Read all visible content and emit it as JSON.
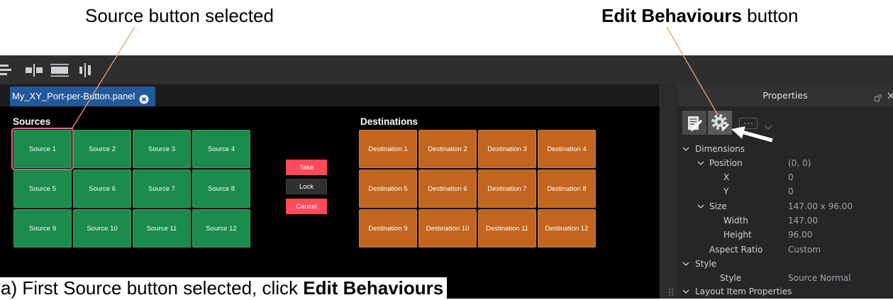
{
  "annotations": {
    "source_callout": "Source button selected",
    "edit_callout_bold": "Edit Behaviours",
    "edit_callout_rest": "button",
    "caption_text": "a) First Source button selected, click",
    "caption_bold": "Edit Behaviours",
    "line_color": "#f2a068"
  },
  "toolbar": {
    "icons": [
      "align-left-icon",
      "align-horizontal-centers-icon",
      "distribute-vertical-icon",
      "align-vertical-centers-icon"
    ]
  },
  "tab": {
    "label": "My_XY_Port-per-Button.panel",
    "close_icon": "close-circle-icon"
  },
  "panel": {
    "sources_title": "Sources",
    "destinations_title": "Destinations",
    "sources": [
      "Source 1",
      "Source 2",
      "Source 3",
      "Source 4",
      "Source 5",
      "Source 6",
      "Source 7",
      "Source 8",
      "Source 9",
      "Source 10",
      "Source 11",
      "Source 12"
    ],
    "selected_source_index": 0,
    "destinations": [
      "Destination 1",
      "Destination 2",
      "Destination 3",
      "Destination 4",
      "Destination 5",
      "Destination 6",
      "Destination 7",
      "Destination 8",
      "Destination 9",
      "Destination 10",
      "Destination 11",
      "Destination 12"
    ],
    "take_label": "Take",
    "lock_label": "Lock",
    "cancel_label": "Cancel",
    "colors": {
      "source": "#1b8c4c",
      "destination": "#c2661f",
      "take": "#ff4b5a",
      "lock": "#303030",
      "cancel": "#ff4b5a",
      "selection": "#e36d89",
      "tab": "#22599a"
    }
  },
  "properties": {
    "title": "Properties",
    "header_icons": [
      "float-icon",
      "close-icon"
    ],
    "toolbar_icons": [
      "edit-properties-icon",
      "edit-behaviours-gear-icon",
      "script-icon",
      "chevron-down-icon"
    ],
    "rows": [
      {
        "label": "Dimensions"
      },
      {
        "label": "Position",
        "value": "(0, 0)"
      },
      {
        "label": "X",
        "value": "0"
      },
      {
        "label": "Y",
        "value": "0"
      },
      {
        "label": "Size",
        "value": "147.00 x 96.00"
      },
      {
        "label": "Width",
        "value": "147.00"
      },
      {
        "label": "Height",
        "value": "96.00"
      },
      {
        "label": "Aspect Ratio",
        "value": "Custom"
      },
      {
        "label": "Style"
      },
      {
        "label": "Style",
        "value": "Source Normal"
      },
      {
        "label": "Layout Item Properties"
      }
    ]
  }
}
